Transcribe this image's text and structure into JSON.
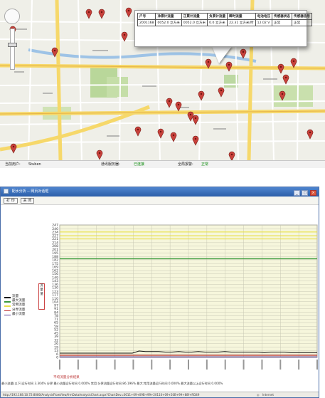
{
  "map": {
    "table_headers": [
      "户号",
      "净累计流量",
      "正累计流量",
      "负累计流量",
      "瞬时流量",
      "电池电压",
      "传感器状态",
      "传感器信号"
    ],
    "table_row": [
      "2001168",
      "0052.0 立方米",
      "0052.0 立方米",
      "0.0 立方米",
      "22.31 立方米/时",
      "12.02 V",
      "正常",
      "正常"
    ],
    "status": {
      "user_label": "当前用户:",
      "user_value": "Stuben",
      "server_label": "通讯服务器:",
      "server_value": "已连接",
      "alarm_label": "全局报警:",
      "alarm_value": "正常"
    }
  },
  "analysis": {
    "window_title": "配水分析 -- 网页对话框",
    "toolbar": {
      "print_label": "打 印",
      "close_label": "关 闭"
    },
    "legend": [
      {
        "name": "流量",
        "color": "#111111"
      },
      {
        "name": "最大流量",
        "color": "#3a9a3a"
      },
      {
        "name": "常用流量",
        "color": "#e8e04a"
      },
      {
        "name": "分界流量",
        "color": "#c03030"
      },
      {
        "name": "最小流量",
        "color": "#5a3a9a"
      }
    ],
    "ylabel_chars": [
      "流",
      "量",
      "值"
    ],
    "summary_title": "平均流量分析结果",
    "summary_text": "最小流量(以下)运行时间 3.304%   分界:最小流量运行时间 0.000%   常用:分界流量运行时间 86.196%   最大:常用流量运行时间 0.000%   最大流量以上运行时间 0.000%",
    "status_url": "http://192.168.10.72:8080/AnalysisFlowView/frmDataAnalysisChart.aspx?ChartDev=0011+09+09B+99+20110+09+20B+99+88f+RD49",
    "status_zone": "Internet"
  },
  "chart_data": {
    "type": "line",
    "yticks": [
      0,
      6,
      13,
      19,
      26,
      32,
      39,
      45,
      52,
      58,
      65,
      71,
      78,
      84,
      91,
      97,
      104,
      110,
      117,
      123,
      130,
      136,
      143,
      149,
      156,
      162,
      169,
      175,
      182,
      188,
      195,
      201,
      208,
      214,
      221,
      227,
      234,
      240,
      247
    ],
    "ylim": [
      0,
      247
    ],
    "grid": true,
    "series": [
      {
        "name": "最大流量",
        "color": "#3a9a3a",
        "values": [
          184
        ]
      },
      {
        "name": "常用流量",
        "color": "#e8e04a",
        "values": [
          234,
          227,
          221
        ]
      },
      {
        "name": "分界流量",
        "color": "#c03030",
        "values": [
          4
        ]
      },
      {
        "name": "最小流量",
        "color": "#5a3a9a",
        "values": [
          1
        ]
      },
      {
        "name": "流量",
        "color": "#111111",
        "values": [
          8,
          8,
          8,
          8,
          8,
          8,
          8,
          8,
          8,
          8,
          8,
          8,
          12,
          11,
          11,
          11,
          10,
          10,
          11,
          10,
          10,
          11,
          10,
          10,
          10,
          11,
          10,
          10,
          10,
          10,
          10,
          9,
          10,
          10,
          10,
          9,
          9,
          9,
          9,
          9
        ]
      }
    ]
  }
}
